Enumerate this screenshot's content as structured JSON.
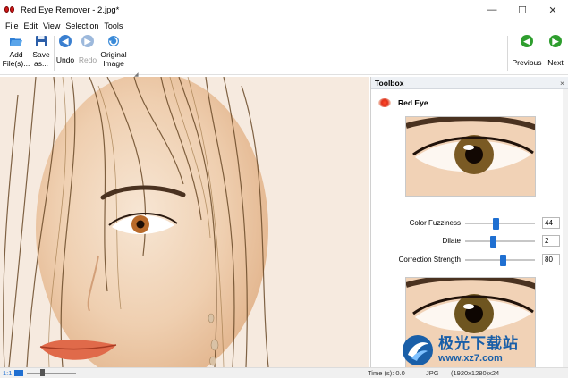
{
  "window": {
    "title": "Red Eye Remover - 2.jpg*",
    "minimize": "—",
    "maximize": "☐",
    "close": "✕"
  },
  "menu": [
    "File",
    "Edit",
    "View",
    "Selection",
    "Tools"
  ],
  "toolbar": {
    "add_files": [
      "Add",
      "File(s)..."
    ],
    "save_as": [
      "Save",
      "as..."
    ],
    "undo": "Undo",
    "redo": "Redo",
    "original_image": [
      "Original",
      "Image"
    ],
    "previous": "Previous",
    "next": "Next"
  },
  "toolbox": {
    "header": "Toolbox",
    "close": "×",
    "tool_name": "Red Eye",
    "params": [
      {
        "label": "Color Fuzziness",
        "value": "44",
        "level": 0.44
      },
      {
        "label": "Dilate",
        "value": "2",
        "level": 0.4
      },
      {
        "label": "Correction Strength",
        "value": "80",
        "level": 0.55
      }
    ]
  },
  "status": {
    "zoom": "1:1",
    "time": "Time (s): 0.0",
    "format": "JPG",
    "info": "(1920x1280)x24"
  },
  "watermark": {
    "cn": "极光下载站",
    "url": "www.xz7.com"
  },
  "colors": {
    "accent": "#1f6fd1",
    "nav_green": "#2e9e2e",
    "undo_blue": "#3a7fd0"
  }
}
